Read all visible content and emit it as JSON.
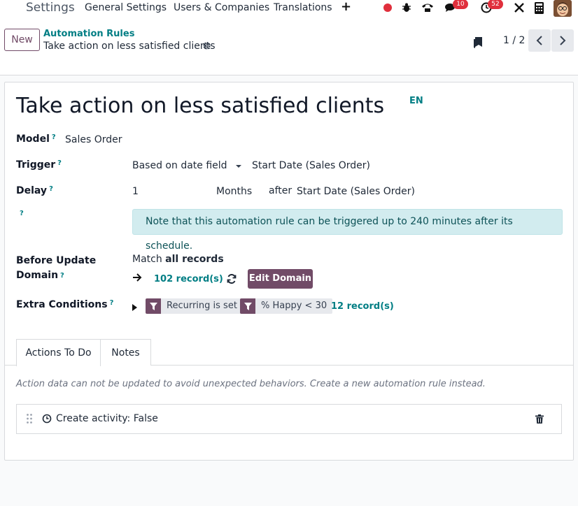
{
  "topbar": {
    "app_name": "Settings",
    "menu": [
      "General Settings",
      "Users & Companies",
      "Translations"
    ],
    "add_icon": "plus-icon",
    "messages_badge": "10",
    "activities_badge": "52",
    "icons": [
      "record-icon",
      "bug-icon",
      "phone-icon",
      "chat-icon",
      "clock-icon",
      "tools-icon",
      "calculator-icon",
      "avatar"
    ]
  },
  "control_panel": {
    "new_label": "New",
    "breadcrumb_parent": "Automation Rules",
    "breadcrumb_current": "Take action on less satisfied clients",
    "pager": "1 / 2"
  },
  "form": {
    "title": "Take action on less satisfied clients",
    "lang": "EN",
    "model_label": "Model",
    "model_value": "Sales Order",
    "trigger_label": "Trigger",
    "trigger_value": "Based on date field",
    "trigger_date_field": "Start Date (Sales Order)",
    "delay_label": "Delay",
    "delay_number": "1",
    "delay_unit": "Months",
    "delay_after": "after",
    "delay_field": "Start Date (Sales Order)",
    "help_mark": "?",
    "alert": "Note that this automation rule can be triggered up to 240 minutes after its schedule.",
    "before_update_label_1": "Before Update",
    "before_update_label_2": "Domain",
    "match_prefix": "Match",
    "match_bold": "all records",
    "domain_records": "102 record(s)",
    "edit_domain_label": "Edit Domain",
    "extra_conditions_label": "Extra Conditions",
    "facets": [
      "Recurring is set",
      "% Happy < 30"
    ],
    "extra_records": "12 record(s)"
  },
  "tabs": [
    {
      "label": "Actions To Do",
      "active": true
    },
    {
      "label": "Notes",
      "active": false
    }
  ],
  "actions": {
    "note": "Action data can not be updated to avoid unexpected behaviors. Create a new automation rule instead.",
    "items": [
      {
        "label": "Create activity: False"
      }
    ]
  },
  "colors": {
    "brand": "#714b67",
    "teal": "#017e84",
    "alert_bg": "#d2ecef",
    "badge": "#e02f3c"
  }
}
